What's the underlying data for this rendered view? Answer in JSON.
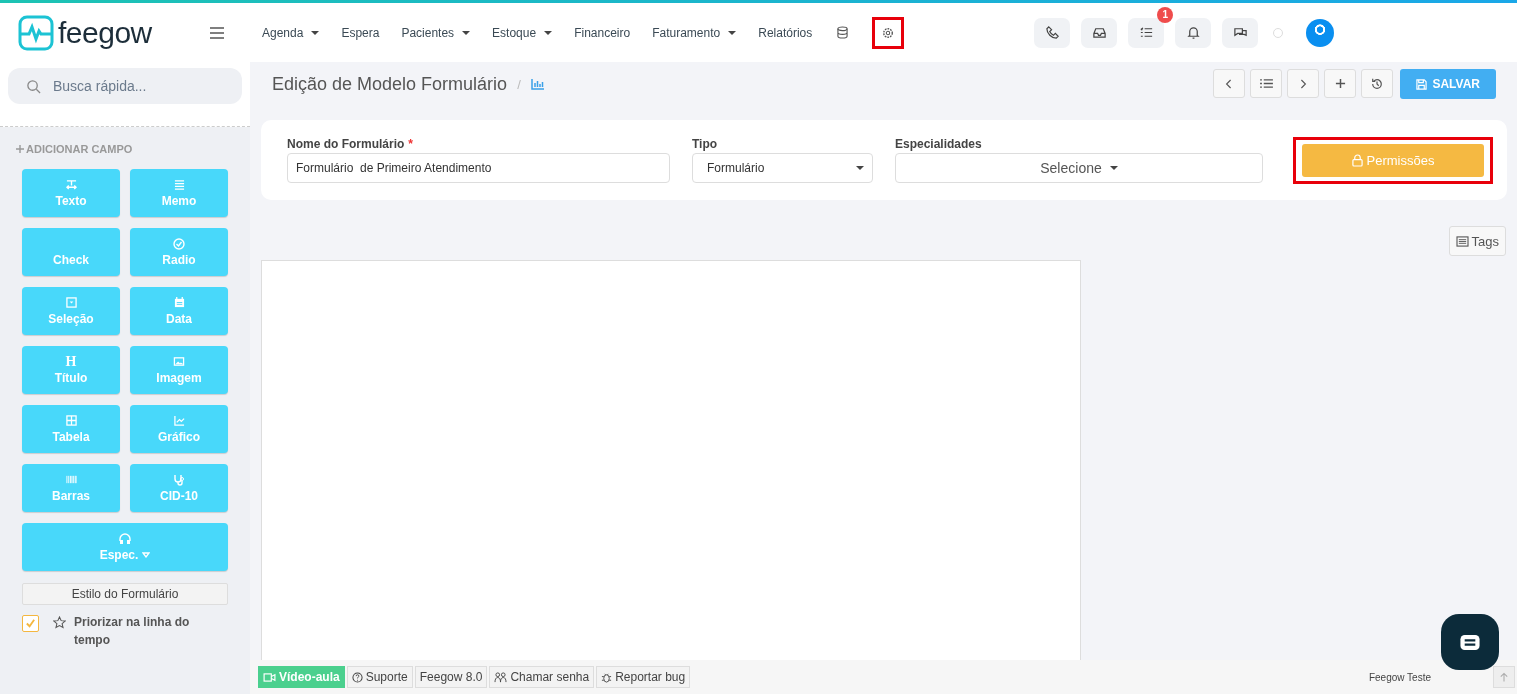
{
  "brand": {
    "name": "feegow"
  },
  "nav": [
    {
      "label": "Agenda",
      "dropdown": true
    },
    {
      "label": "Espera",
      "dropdown": false
    },
    {
      "label": "Pacientes",
      "dropdown": true
    },
    {
      "label": "Estoque",
      "dropdown": true
    },
    {
      "label": "Financeiro",
      "dropdown": false
    },
    {
      "label": "Faturamento",
      "dropdown": true
    },
    {
      "label": "Relatórios",
      "dropdown": false
    }
  ],
  "nav_icons": [
    {
      "kind": "database",
      "highlighted": false
    },
    {
      "kind": "settings",
      "highlighted": true
    }
  ],
  "toolbar": [
    {
      "kind": "phone"
    },
    {
      "kind": "inbox"
    },
    {
      "kind": "tasks",
      "badge": "1"
    },
    {
      "kind": "bell"
    },
    {
      "kind": "chat"
    }
  ],
  "search": {
    "placeholder": "Busca rápida..."
  },
  "sidebar": {
    "heading": "ADICIONAR CAMPO",
    "fields": [
      {
        "label": "Texto",
        "kind": "text",
        "wide": false
      },
      {
        "label": "Memo",
        "kind": "memo",
        "wide": false
      },
      {
        "label": "Check",
        "kind": "check",
        "wide": false
      },
      {
        "label": "Radio",
        "kind": "radio",
        "wide": false
      },
      {
        "label": "Seleção",
        "kind": "select",
        "wide": false
      },
      {
        "label": "Data",
        "kind": "date",
        "wide": false
      },
      {
        "label": "Título",
        "kind": "title",
        "glyph": "H",
        "wide": false
      },
      {
        "label": "Imagem",
        "kind": "image",
        "wide": false
      },
      {
        "label": "Tabela",
        "kind": "table",
        "wide": false
      },
      {
        "label": "Gráfico",
        "kind": "chart",
        "wide": false
      },
      {
        "label": "Barras",
        "kind": "barcode",
        "wide": false
      },
      {
        "label": "CID-10",
        "kind": "stethoscope",
        "wide": false
      },
      {
        "label": "Espec.",
        "kind": "headphones",
        "wide": true
      }
    ],
    "style_button": "Estilo do Formulário",
    "priority": {
      "label": "Priorizar na linha do tempo",
      "checked": true
    }
  },
  "page": {
    "title": "Edição de Modelo Formulário",
    "separator": "/",
    "save": "SALVAR"
  },
  "form": {
    "name": {
      "label": "Nome do Formulário",
      "required_mark": "*",
      "value": "Formulário  de Primeiro Atendimento"
    },
    "type": {
      "label": "Tipo",
      "value": "Formulário"
    },
    "specialties": {
      "label": "Especialidades",
      "value": "Selecione"
    },
    "permissions": {
      "label": "Permissões",
      "highlighted": true
    }
  },
  "tags": "Tags",
  "footer": [
    {
      "label": "Vídeo-aula",
      "kind": "video"
    },
    {
      "label": "Suporte",
      "kind": "help"
    },
    {
      "label": "Feegow 8.0",
      "kind": "plain"
    },
    {
      "label": "Chamar senha",
      "kind": "people"
    },
    {
      "label": "Reportar bug",
      "kind": "bug"
    }
  ],
  "footer_right": "Feegow Teste"
}
